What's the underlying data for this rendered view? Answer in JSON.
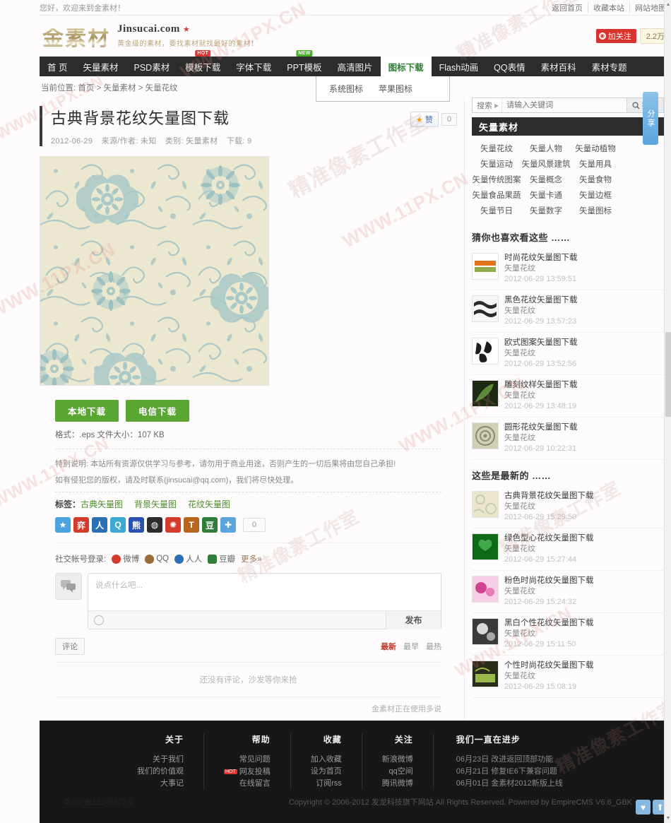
{
  "topbar": {
    "greeting": "您好，欢迎来到金素材！",
    "links": [
      "返回首页",
      "收藏本站",
      "网站地图"
    ]
  },
  "header": {
    "logo_cn": "金素材",
    "domain": "Jinsucai.com",
    "star": "★",
    "slogan": "黄金级的素材，要找素材就找最好的素材！",
    "follow_label": "加关注",
    "follow_icon": "◉",
    "follow_count": "2.2万"
  },
  "nav": {
    "items": [
      {
        "label": "首 页",
        "active": false,
        "badge": ""
      },
      {
        "label": "矢量素材",
        "active": false,
        "badge": ""
      },
      {
        "label": "PSD素材",
        "active": false,
        "badge": ""
      },
      {
        "label": "模板下载",
        "active": false,
        "badge": "HOT"
      },
      {
        "label": "字体下载",
        "active": false,
        "badge": ""
      },
      {
        "label": "PPT模板",
        "active": false,
        "badge": "NEW"
      },
      {
        "label": "高清图片",
        "active": false,
        "badge": ""
      },
      {
        "label": "图标下载",
        "active": true,
        "badge": ""
      },
      {
        "label": "Flash动画",
        "active": false,
        "badge": ""
      },
      {
        "label": "QQ表情",
        "active": false,
        "badge": ""
      },
      {
        "label": "素材百科",
        "active": false,
        "badge": ""
      },
      {
        "label": "素材专题",
        "active": false,
        "badge": ""
      }
    ],
    "dropdown": [
      "系统图标",
      "苹果图标"
    ]
  },
  "breadcrumb": {
    "prefix": "当前位置:",
    "items": [
      "首页",
      "矢量素材",
      "矢量花纹"
    ],
    "sep": ">"
  },
  "article": {
    "title": "古典背景花纹矢量图下载",
    "date": "2012-06-29",
    "source": "来源/作者: 未知",
    "category": "类别: 矢量素材",
    "downloads": "下载: 9",
    "zan_label": "赞",
    "zan_star": "★",
    "zan_count": "0"
  },
  "download": {
    "local_label": "本地下载",
    "telecom_label": "电信下载",
    "format_line": "格式：.eps  文件大小：107 KB",
    "notice1": "特别说明: 本站所有资源仅供学习与参考，请勿用于商业用途，否则产生的一切后果将由您自己承担!",
    "notice2": "如有侵犯您的版权，请及时联系(jinsucai@qq.com)，我们将尽快处理。",
    "tags_label": "标签：",
    "tags": [
      "古典矢量图",
      "背景矢量图",
      "花纹矢量图"
    ]
  },
  "share": {
    "icons": [
      {
        "name": "favorite-star-icon",
        "glyph": "★",
        "color": "#4aa3df"
      },
      {
        "name": "sina-weibo-icon",
        "glyph": "弈",
        "color": "#d33b2c"
      },
      {
        "name": "renren-icon",
        "glyph": "人",
        "color": "#2b6fb5"
      },
      {
        "name": "qzone-icon",
        "glyph": "Q",
        "color": "#3fa9d6"
      },
      {
        "name": "baidu-icon",
        "glyph": "熊",
        "color": "#2a4fae"
      },
      {
        "name": "tencent-weibo-icon",
        "glyph": "◍",
        "color": "#2c2c2c"
      },
      {
        "name": "kaixin-icon",
        "glyph": "✺",
        "color": "#d33b2c"
      },
      {
        "name": "tianya-icon",
        "glyph": "T",
        "color": "#b8651e"
      },
      {
        "name": "douban-icon",
        "glyph": "豆",
        "color": "#2f7d3a"
      },
      {
        "name": "more-share-icon",
        "glyph": "✚",
        "color": "#5aa5de"
      }
    ],
    "count": "0",
    "rail_label": "分享"
  },
  "sociallogin": {
    "label": "社交帐号登录:",
    "accounts": [
      {
        "name": "weibo",
        "label": "微博",
        "color": "#d33b2c"
      },
      {
        "name": "qq",
        "label": "QQ",
        "color": "#9a6a3a"
      },
      {
        "name": "renren",
        "label": "人人",
        "color": "#2b6fb5"
      },
      {
        "name": "douban",
        "label": "豆瓣",
        "color": "#2f7d3a"
      }
    ],
    "more": "更多»"
  },
  "comments": {
    "placeholder": "说点什么吧...",
    "post_label": "发布",
    "tab_label": "评论",
    "sorts": [
      {
        "label": "最新",
        "active": true
      },
      {
        "label": "最早",
        "active": false
      },
      {
        "label": "最热",
        "active": false
      }
    ],
    "empty": "还没有评论，沙发等你来抢",
    "powered": "金素材正在使用多说"
  },
  "sidebar": {
    "search": {
      "label": "搜索",
      "arrow": "▶",
      "placeholder": "请输入关键词",
      "button": "搜索",
      "icon": "search-icon"
    },
    "cat_header": "矢量素材",
    "cat_chevron": "❯",
    "categories": [
      "矢量花纹",
      "矢量人物",
      "矢量动植物",
      "矢量运动",
      "矢量风景建筑",
      "矢量用具",
      "矢量传统图案",
      "矢量概念",
      "矢量食物",
      "矢量食品果蔬",
      "矢量卡通",
      "矢量边框",
      "矢量节日",
      "矢量数字",
      "矢量图标"
    ],
    "recommend_title": "猜你也喜欢看这些 ……",
    "recommend": [
      {
        "title": "时尚花纹矢量图下载",
        "cat": "矢量花纹",
        "date": "2012-06-29 13:59:51",
        "c1": "#e2731d",
        "c2": "#8fae4a"
      },
      {
        "title": "黑色花纹矢量图下载",
        "cat": "矢量花纹",
        "date": "2012-06-29 13:57:23",
        "c1": "#f3f3f3",
        "c2": "#2a2a2a"
      },
      {
        "title": "欧式图案矢量图下载",
        "cat": "矢量花纹",
        "date": "2012-06-29 13:52:56",
        "c1": "#ffffff",
        "c2": "#1d1d1d"
      },
      {
        "title": "雕刻纹样矢量图下载",
        "cat": "矢量花纹",
        "date": "2012-06-29 13:48:19",
        "c1": "#1c2a14",
        "c2": "#5e8b3a"
      },
      {
        "title": "圆形花纹矢量图下载",
        "cat": "矢量花纹",
        "date": "2012-06-29 10:22:31",
        "c1": "#cfd0b6",
        "c2": "#8b8d6a"
      }
    ],
    "newest_title": "这些是最新的 ……",
    "newest": [
      {
        "title": "古典背景花纹矢量图下载",
        "cat": "矢量花纹",
        "date": "2012-06-29 15:29:50",
        "c1": "#e9e6cc",
        "c2": "#c8cbb0"
      },
      {
        "title": "绿色型心花纹矢量图下载",
        "cat": "矢量花纹",
        "date": "2012-06-29 15:27:44",
        "c1": "#0d6b18",
        "c2": "#3fa84a"
      },
      {
        "title": "粉色时尚花纹矢量图下载",
        "cat": "矢量花纹",
        "date": "2012-06-29 15:24:32",
        "c1": "#f0a8d0",
        "c2": "#d1438f"
      },
      {
        "title": "黑白个性花纹矢量图下载",
        "cat": "矢量花纹",
        "date": "2012-06-29 15:11:50",
        "c1": "#3a3a3a",
        "c2": "#d8d8d8"
      },
      {
        "title": "个性时尚花纹矢量图下载",
        "cat": "矢量花纹",
        "date": "2012-06-29 15:08:19",
        "c1": "#2b2b1a",
        "c2": "#9ab84a"
      }
    ]
  },
  "footer": {
    "columns": [
      {
        "heading": "关于",
        "links": [
          {
            "label": "关于我们"
          },
          {
            "label": "我们的价值观"
          },
          {
            "label": "大事记"
          }
        ]
      },
      {
        "heading": "帮助",
        "links": [
          {
            "label": "常见问题"
          },
          {
            "label": "网友投稿",
            "badge": "HOT"
          },
          {
            "label": "在线留言"
          }
        ]
      },
      {
        "heading": "收藏",
        "links": [
          {
            "label": "加入收藏"
          },
          {
            "label": "设为首页"
          },
          {
            "label": "订阅rss"
          }
        ]
      },
      {
        "heading": "关注",
        "links": [
          {
            "label": "新浪微博"
          },
          {
            "label": "qq空间"
          },
          {
            "label": "腾讯微博"
          }
        ]
      }
    ],
    "news_heading": "我们一直在进步",
    "news": [
      "06月23日 改进返回顶部功能",
      "06月21日 修复IE6下兼容问题",
      "06月01日 金素材2012新版上线"
    ],
    "icp": "粤ICP备12345677号",
    "copyright": "Copyright © 2006-2012 发龙科技旗下网站 All Rights Reserved. Powered by EmpireCMS V6.6_GBK",
    "buttons": [
      {
        "name": "favorite-heart-button",
        "glyph": "♥"
      },
      {
        "name": "back-to-top-button",
        "glyph": "⬆"
      }
    ]
  },
  "watermarks": [
    "WWW.11PX.CN",
    "精准像素工作室"
  ]
}
